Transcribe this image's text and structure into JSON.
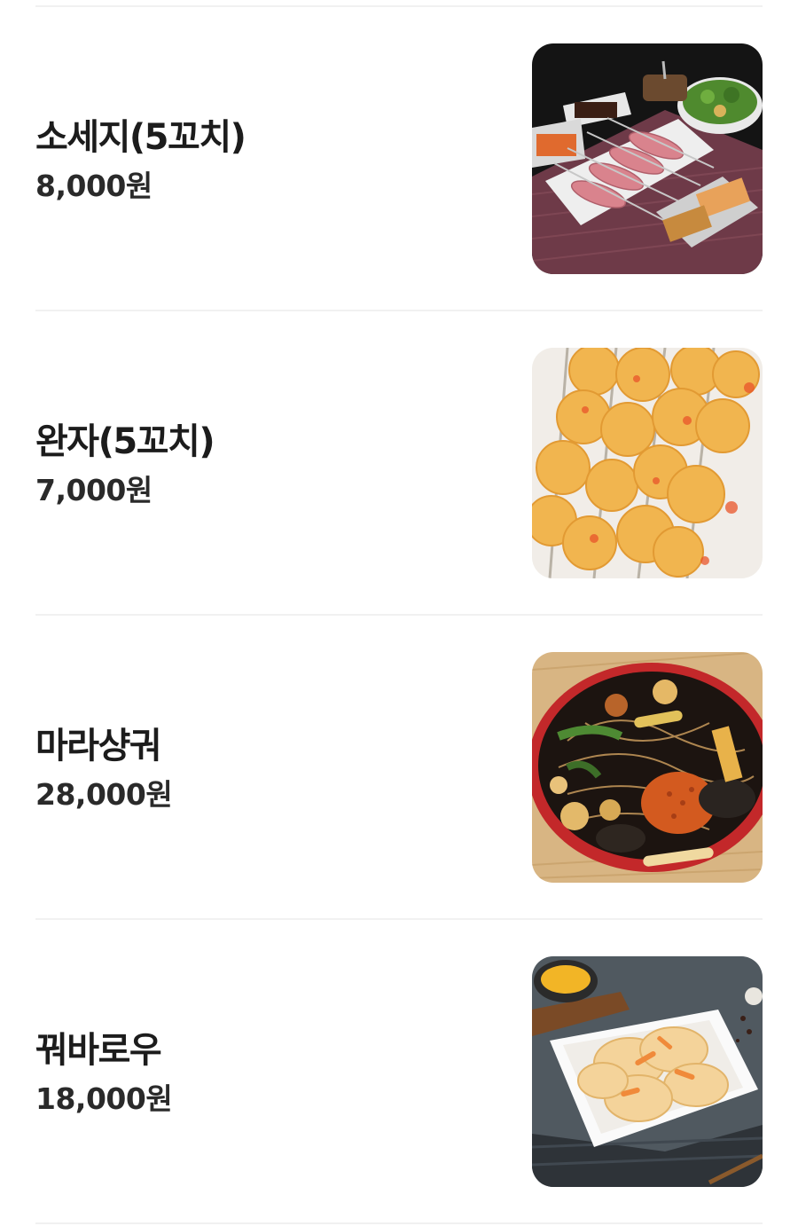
{
  "menu": {
    "items": [
      {
        "name": "소세지(5꼬치)",
        "price": "8,000원",
        "photo_icon": "sausage-skewers-photo"
      },
      {
        "name": "완자(5꼬치)",
        "price": "7,000원",
        "photo_icon": "meatball-skewers-photo"
      },
      {
        "name": "마라샹궈",
        "price": "28,000원",
        "photo_icon": "mala-xiangguo-photo"
      },
      {
        "name": "꿔바로우",
        "price": "18,000원",
        "photo_icon": "guobaorou-photo"
      }
    ]
  }
}
